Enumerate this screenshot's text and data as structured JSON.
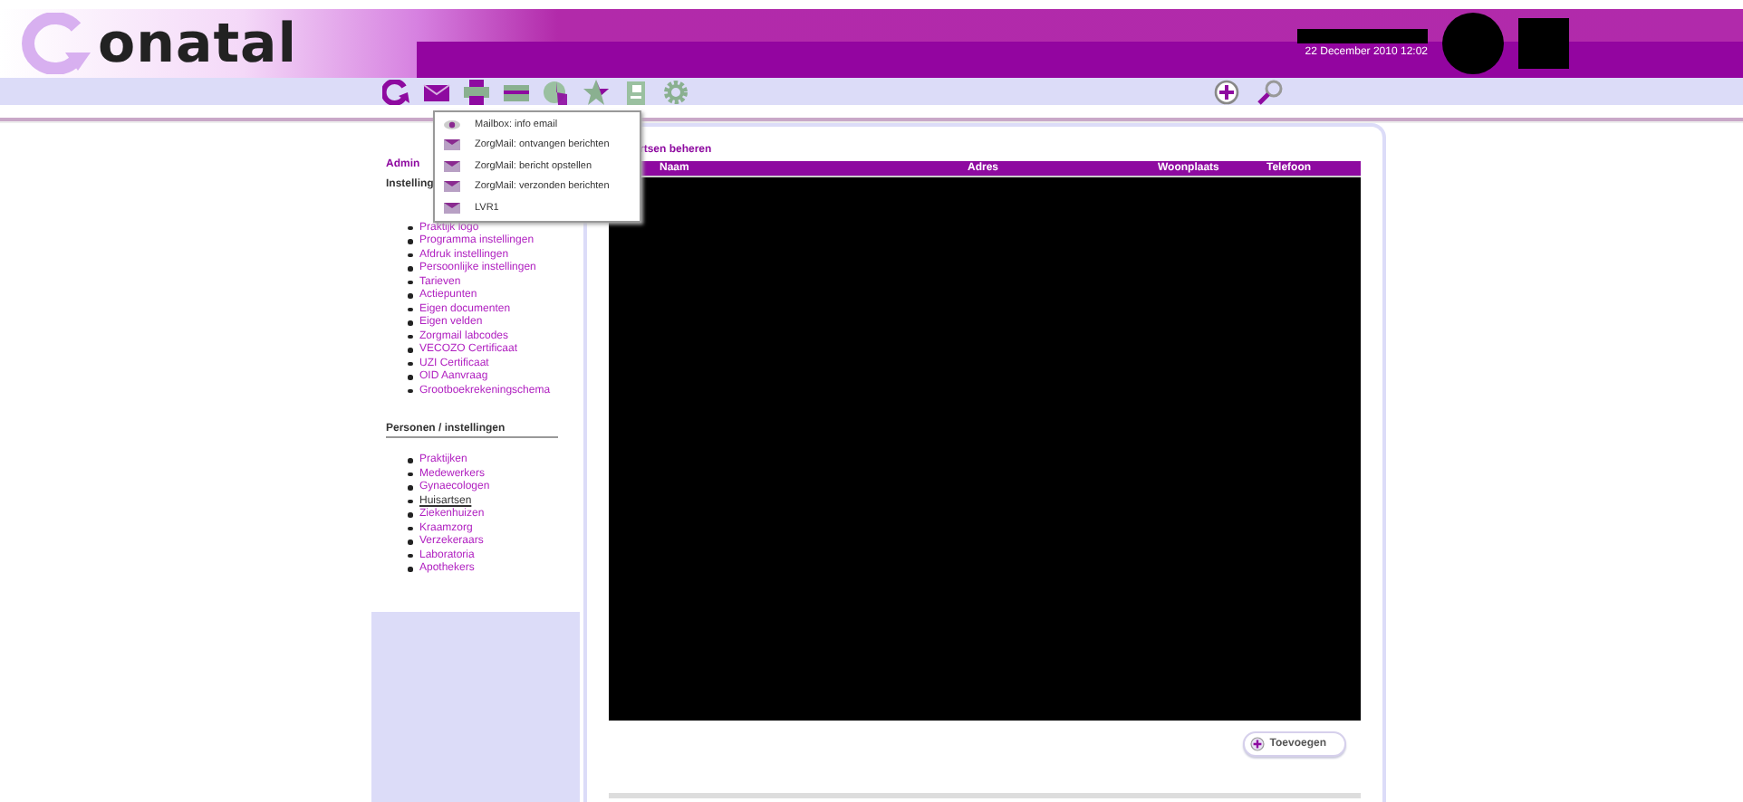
{
  "header": {
    "logo_text": "onatal",
    "datetime": "22 December 2010 12:02"
  },
  "mail_menu": {
    "items": [
      {
        "kind": "eye",
        "label": "Mailbox: info email"
      },
      {
        "kind": "mail",
        "label": "ZorgMail: ontvangen berichten"
      },
      {
        "kind": "mail",
        "label": "ZorgMail: bericht opstellen"
      },
      {
        "kind": "mail",
        "label": "ZorgMail: verzonden berichten"
      },
      {
        "kind": "mail",
        "label": "LVR1"
      }
    ]
  },
  "sidebar": {
    "admin_label": "Admin",
    "settings_heading": "Instelling",
    "settings_items": [
      {
        "label": "Praktijk logo",
        "selected": false
      },
      {
        "label": "Programma instellingen",
        "selected": false
      },
      {
        "label": "Afdruk instellingen",
        "selected": false
      },
      {
        "label": "Persoonlijke instellingen",
        "selected": false
      },
      {
        "label": "Tarieven",
        "selected": false
      },
      {
        "label": "Actiepunten",
        "selected": false
      },
      {
        "label": "Eigen documenten",
        "selected": false
      },
      {
        "label": "Eigen velden",
        "selected": false
      },
      {
        "label": "Zorgmail labcodes",
        "selected": false
      },
      {
        "label": "VECOZO Certificaat",
        "selected": false
      },
      {
        "label": "UZI Certificaat",
        "selected": false
      },
      {
        "label": "OID Aanvraag",
        "selected": false
      },
      {
        "label": "Grootboekrekeningschema",
        "selected": false
      }
    ],
    "persons_heading": "Personen / instellingen",
    "persons_items": [
      {
        "label": "Praktijken",
        "selected": false
      },
      {
        "label": "Medewerkers",
        "selected": false
      },
      {
        "label": "Gynaecologen",
        "selected": false
      },
      {
        "label": "Huisartsen",
        "selected": true
      },
      {
        "label": "Ziekenhuizen",
        "selected": false
      },
      {
        "label": "Kraamzorg",
        "selected": false
      },
      {
        "label": "Verzekeraars",
        "selected": false
      },
      {
        "label": "Laboratoria",
        "selected": false
      },
      {
        "label": "Apothekers",
        "selected": false
      }
    ]
  },
  "main": {
    "title": "rtsen beheren",
    "table": {
      "columns": [
        "Naam",
        "Adres",
        "Woonplaats",
        "Telefoon"
      ]
    },
    "add_button": "Toevoegen"
  }
}
